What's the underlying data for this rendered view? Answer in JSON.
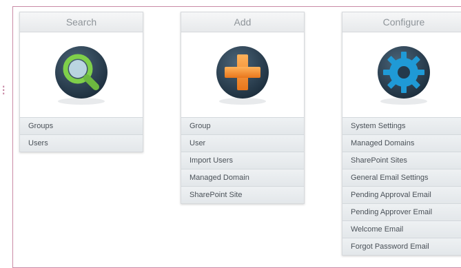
{
  "search": {
    "title": "Search",
    "icon": "magnifier-icon",
    "items": [
      "Groups",
      "Users"
    ]
  },
  "add": {
    "title": "Add",
    "icon": "plus-icon",
    "items": [
      "Group",
      "User",
      "Import Users",
      "Managed Domain",
      "SharePoint Site"
    ]
  },
  "configure": {
    "title": "Configure",
    "icon": "gear-icon",
    "items": [
      "System Settings",
      "Managed Domains",
      "SharePoint Sites",
      "General Email Settings",
      "Pending Approval Email",
      "Pending Approver Email",
      "Welcome Email",
      "Forgot Password Email"
    ]
  },
  "colors": {
    "frame_border": "#c98aa6",
    "panel_header_text": "#8e9499",
    "item_text": "#4a5158",
    "search_accent": "#7fcf4a",
    "add_accent": "#f08a2c",
    "configure_accent": "#1f9ad6",
    "icon_bg": "#243a4c"
  }
}
